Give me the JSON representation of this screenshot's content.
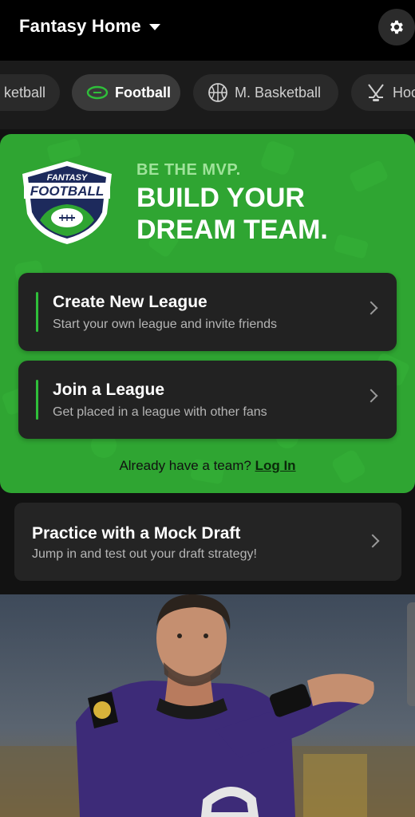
{
  "header": {
    "title": "Fantasy Home",
    "icons": {
      "dropdown": "chevron-down-icon",
      "settings": "gear-icon"
    }
  },
  "tabs": [
    {
      "label": "Basketball",
      "visible_text": "ketball",
      "icon": "basketball-icon"
    },
    {
      "label": "Football",
      "icon": "football-icon",
      "active": true
    },
    {
      "label": "M. Basketball",
      "icon": "basketball-icon"
    },
    {
      "label": "Hockey",
      "visible_text": "Hoc",
      "icon": "hockey-icon"
    }
  ],
  "hero": {
    "logo_text": [
      "FANTASY",
      "FOOTBALL"
    ],
    "tagline_small": "BE THE MVP.",
    "tagline_big": "BUILD YOUR DREAM TEAM.",
    "create": {
      "title": "Create New League",
      "subtitle": "Start your own league and invite friends"
    },
    "join": {
      "title": "Join a League",
      "subtitle": "Get placed in a league with other fans"
    },
    "already_text": "Already have a team?",
    "login_label": "Log In"
  },
  "mock_draft": {
    "title": "Practice with a Mock Draft",
    "subtitle": "Jump in and test out your draft strategy!"
  },
  "colors": {
    "accent_green": "#2fa532",
    "card_bg": "#222222",
    "header_bg": "#000000"
  }
}
